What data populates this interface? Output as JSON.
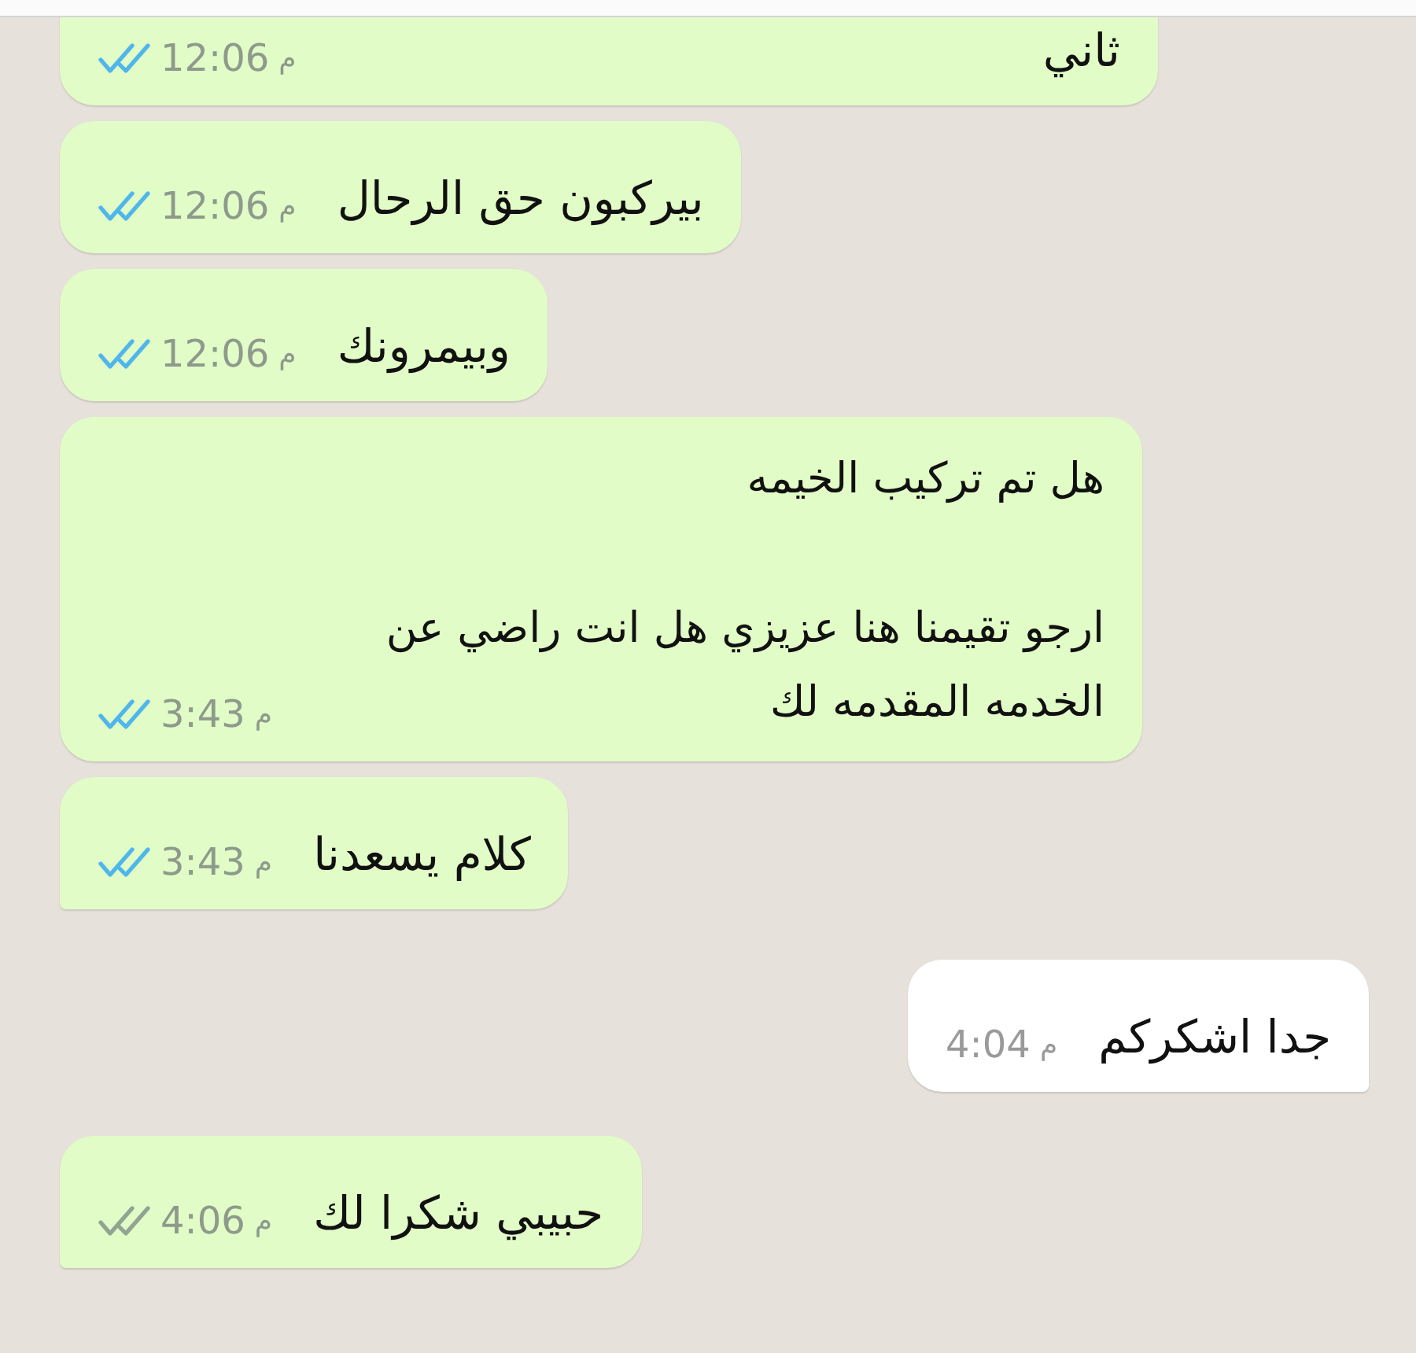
{
  "messages": [
    {
      "kind": "sent",
      "text": "ثاني",
      "time": "12:06",
      "period": "م",
      "read": true,
      "tail": false
    },
    {
      "kind": "sent",
      "text": "بيركبون حق الرحال",
      "time": "12:06",
      "period": "م",
      "read": true,
      "tail": false
    },
    {
      "kind": "sent",
      "text": "وبيمرونك",
      "time": "12:06",
      "period": "م",
      "read": true,
      "tail": false
    },
    {
      "kind": "sent",
      "text": "هل تم تركيب الخيمه\n\nارجو تقيمنا هنا عزيزي هل انت راضي عن الخدمه المقدمه لك",
      "time": "3:43",
      "period": "م",
      "read": true,
      "tail": false
    },
    {
      "kind": "sent",
      "text": "كلام يسعدنا",
      "time": "3:43",
      "period": "م",
      "read": true,
      "tail": true
    },
    {
      "kind": "received",
      "text": "جدا  اشكركم",
      "time": "4:04",
      "period": "م",
      "tail": true
    },
    {
      "kind": "sent",
      "text": "حبيبي شكرا لك",
      "time": "4:06",
      "period": "م",
      "read": false,
      "tail": true
    }
  ]
}
